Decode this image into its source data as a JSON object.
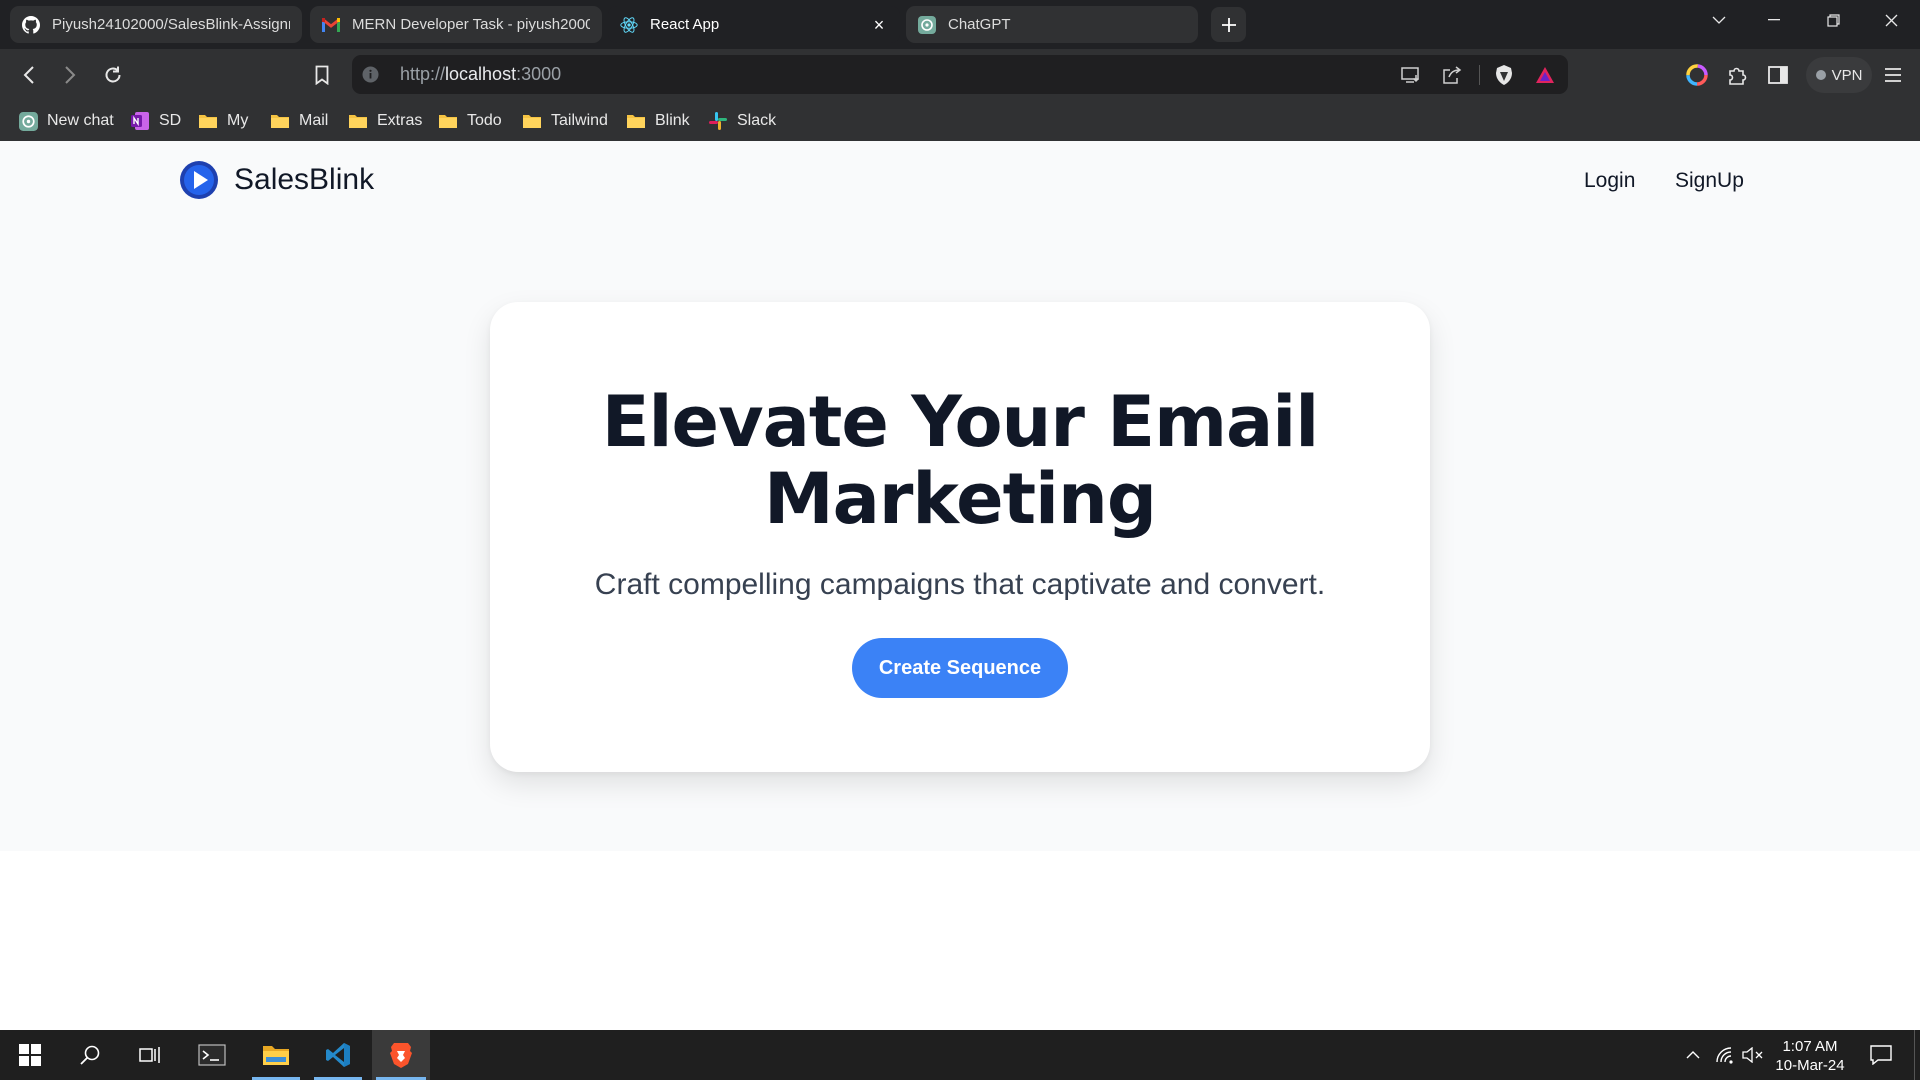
{
  "browser": {
    "tabs": [
      {
        "title": "Piyush24102000/SalesBlink-Assignm",
        "icon": "github-icon"
      },
      {
        "title": "MERN Developer Task - piyush2000",
        "icon": "gmail-icon"
      },
      {
        "title": "React App",
        "icon": "react-icon",
        "active": true
      },
      {
        "title": "ChatGPT",
        "icon": "chatgpt-icon"
      }
    ],
    "address": {
      "scheme": "http://",
      "host": "localhost",
      "port": ":3000"
    },
    "vpn_label": "VPN",
    "bookmarks": [
      {
        "label": "New chat",
        "icon": "chatgpt-icon"
      },
      {
        "label": "SD",
        "icon": "onenote-icon"
      },
      {
        "label": "My",
        "icon": "folder-icon"
      },
      {
        "label": "Mail",
        "icon": "folder-icon"
      },
      {
        "label": "Extras",
        "icon": "folder-icon"
      },
      {
        "label": "Todo",
        "icon": "folder-icon"
      },
      {
        "label": "Tailwind",
        "icon": "folder-icon"
      },
      {
        "label": "Blink",
        "icon": "folder-icon"
      },
      {
        "label": "Slack",
        "icon": "slack-icon"
      }
    ]
  },
  "app": {
    "brand": "SalesBlink",
    "nav": {
      "login": "Login",
      "signup": "SignUp"
    },
    "hero": {
      "title_line1": "Elevate Your Email",
      "title_line2": "Marketing",
      "subtitle": "Craft compelling campaigns that captivate and convert.",
      "cta": "Create Sequence"
    },
    "colors": {
      "accent": "#3b82f6",
      "text": "#111827",
      "page_bg": "#f9fafb"
    }
  },
  "taskbar": {
    "time": "1:07 AM",
    "date": "10-Mar-24",
    "apps": [
      "windows-start-icon",
      "search-icon",
      "task-view-icon",
      "terminal-icon",
      "file-explorer-icon",
      "vscode-icon",
      "brave-icon"
    ]
  }
}
